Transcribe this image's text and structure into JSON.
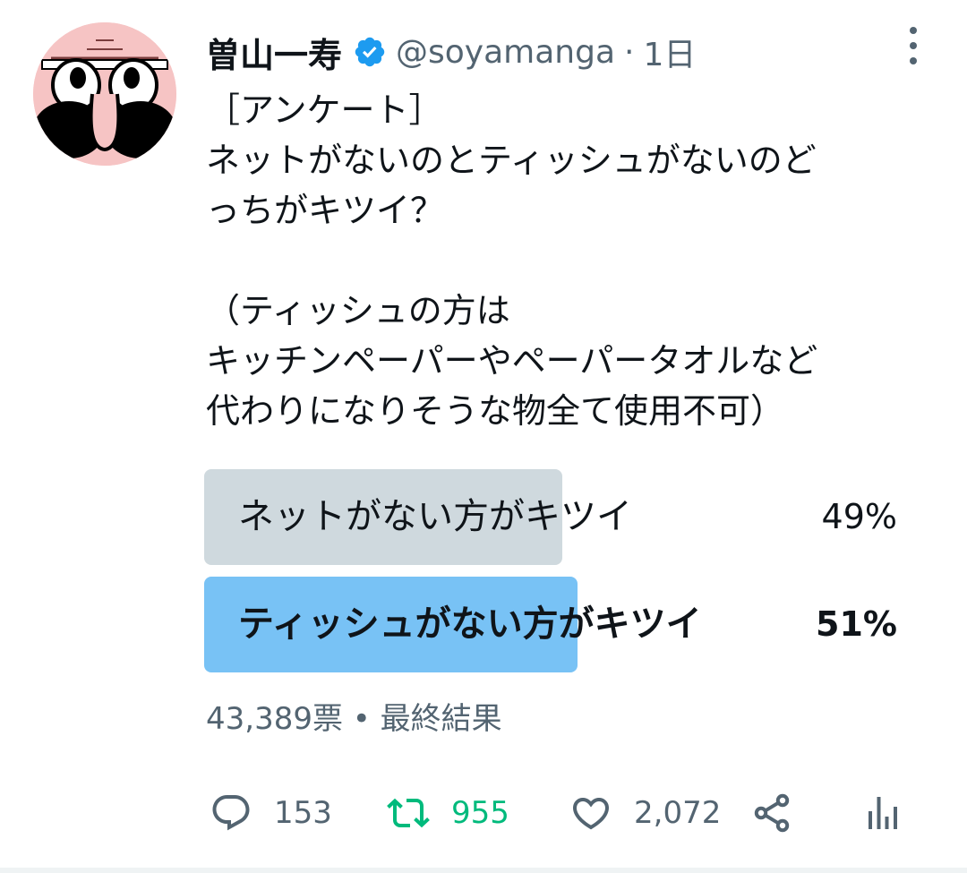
{
  "author": {
    "name": "曽山一寿",
    "handle": "@soyamanga",
    "separator": "·",
    "time": "1日"
  },
  "tweet": {
    "lines": [
      "［アンケート］",
      "ネットがないのとティッシュがないのど",
      "っちがキツイ？",
      "",
      "（ティッシュの方は",
      "キッチンペーパーやペーパータオルなど",
      "代わりになりそうな物全て使用不可）"
    ]
  },
  "poll": {
    "options": [
      {
        "label": "ネットがない方がキツイ",
        "percent": "49%",
        "value": 0.49,
        "winner": false,
        "bar_color": "#cfd9de"
      },
      {
        "label": "ティッシュがない方がキツイ",
        "percent": "51%",
        "value": 0.51,
        "winner": true,
        "bar_color": "#78c2f5"
      }
    ],
    "votes": "43,389票",
    "meta_separator": "•",
    "status": "最終結果"
  },
  "actions": {
    "reply": {
      "icon": "reply-icon",
      "count": "153"
    },
    "retweet": {
      "icon": "retweet-icon",
      "count": "955"
    },
    "like": {
      "icon": "heart-icon",
      "count": "2,072"
    },
    "share": {
      "icon": "share-icon"
    },
    "analytics": {
      "icon": "analytics-icon"
    }
  },
  "colors": {
    "text": "#0f1419",
    "secondary": "#536471",
    "verified": "#1d9bf0",
    "retweet": "#00ba7c",
    "poll_loser": "#cfd9de",
    "poll_winner": "#78c2f5"
  }
}
